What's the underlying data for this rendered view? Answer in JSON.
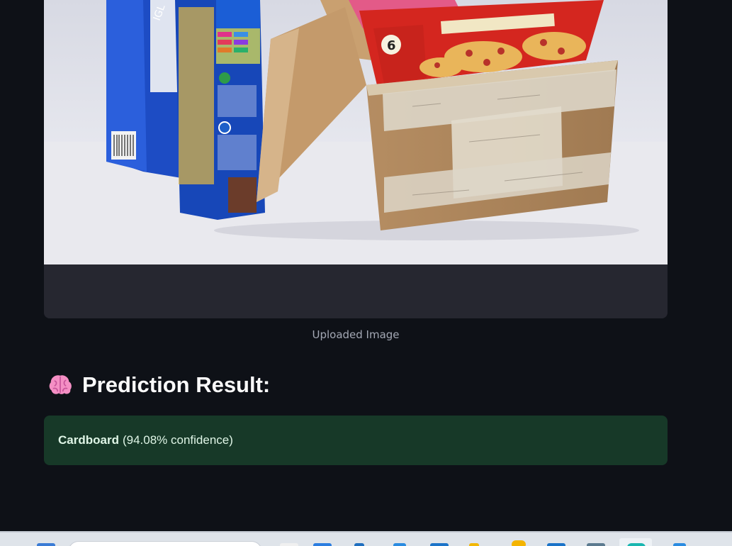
{
  "uploaded_image": {
    "caption": "Uploaded Image"
  },
  "prediction": {
    "heading": "Prediction Result:",
    "heading_icon": "brain-icon",
    "class_label": "Cardboard",
    "confidence_text": "(94.08% confidence)",
    "confidence": 94.08
  },
  "colors": {
    "page_background": "#0e1117",
    "success_box": "#173928",
    "success_text": "#dff5e6",
    "caption_text": "#a3a8b4",
    "frame_background": "#262730"
  }
}
